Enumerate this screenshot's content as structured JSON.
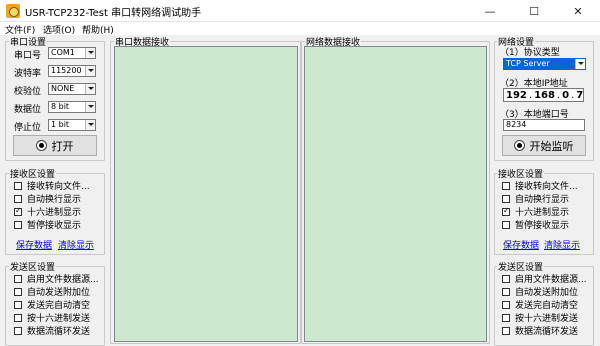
{
  "window": {
    "title": "USR-TCP232-Test 串口转网络调试助手",
    "minimize": "—",
    "maximize": "☐",
    "close": "✕"
  },
  "menu": [
    "文件(F)",
    "选项(O)",
    "帮助(H)"
  ],
  "serial_settings": {
    "title": "串口设置",
    "fields": [
      {
        "label": "串口号",
        "value": "COM1"
      },
      {
        "label": "波特率",
        "value": "115200"
      },
      {
        "label": "校验位",
        "value": "NONE"
      },
      {
        "label": "数据位",
        "value": "8 bit"
      },
      {
        "label": "停止位",
        "value": "1 bit"
      }
    ],
    "open_button": "打开"
  },
  "left_receive": {
    "title": "接收区设置",
    "options": [
      {
        "label": "接收转向文件...",
        "checked": false
      },
      {
        "label": "自动换行显示",
        "checked": false
      },
      {
        "label": "十六进制显示",
        "checked": true
      },
      {
        "label": "暂停接收显示",
        "checked": false
      }
    ],
    "save_link": "保存数据",
    "clear_link": "清除显示"
  },
  "left_send": {
    "title": "发送区设置",
    "options": [
      {
        "label": "启用文件数据源...",
        "checked": false
      },
      {
        "label": "自动发送附加位",
        "checked": false
      },
      {
        "label": "发送完自动清空",
        "checked": false
      },
      {
        "label": "按十六进制发送",
        "checked": false
      },
      {
        "label": "数据流循环发送",
        "checked": false
      }
    ]
  },
  "serial_receive_panel": {
    "title": "串口数据接收"
  },
  "network_receive_panel": {
    "title": "网络数据接收"
  },
  "network_settings": {
    "title": "网络设置",
    "protocol_label": "（1）协议类型",
    "protocol_value": "TCP Server",
    "ip_label": "（2）本地IP地址",
    "ip_parts": [
      "192",
      "168",
      "0",
      "7"
    ],
    "port_label": "（3）本地端口号",
    "port_value": "8234",
    "listen_button": "开始监听"
  },
  "right_receive": {
    "title": "接收区设置",
    "options": [
      {
        "label": "接收转向文件...",
        "checked": false
      },
      {
        "label": "自动换行显示",
        "checked": false
      },
      {
        "label": "十六进制显示",
        "checked": true
      },
      {
        "label": "暂停接收显示",
        "checked": false
      }
    ],
    "save_link": "保存数据",
    "clear_link": "清除显示"
  },
  "right_send": {
    "title": "发送区设置",
    "options": [
      {
        "label": "启用文件数据源...",
        "checked": false
      },
      {
        "label": "自动发送附加位",
        "checked": false
      },
      {
        "label": "发送完自动清空",
        "checked": false
      },
      {
        "label": "按十六进制发送",
        "checked": false
      },
      {
        "label": "数据流循环发送",
        "checked": false
      }
    ]
  }
}
